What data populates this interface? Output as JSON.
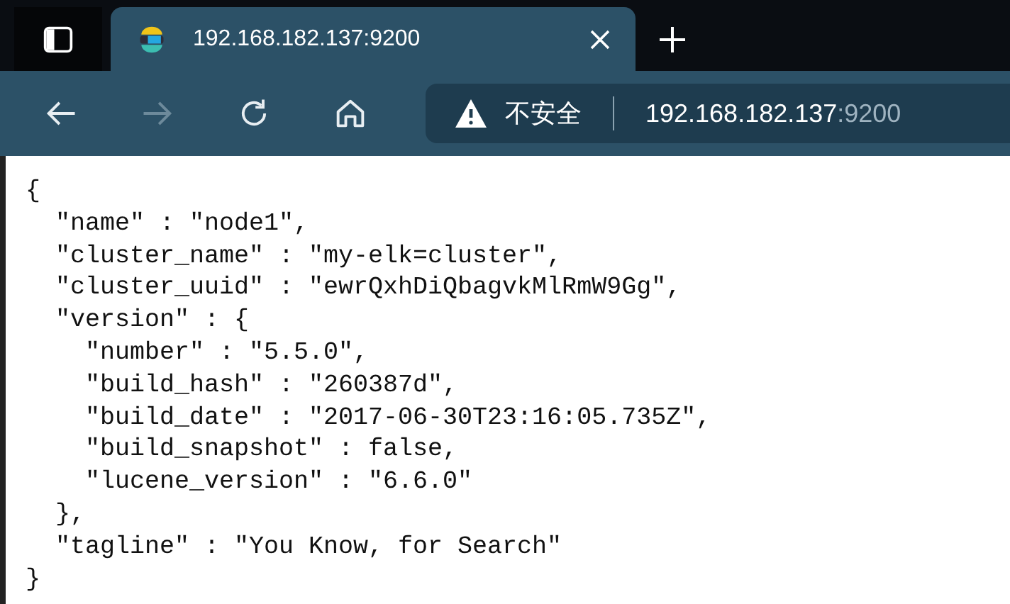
{
  "tabs": [
    {
      "title": "192.168.182.137:9200",
      "selected": true
    }
  ],
  "toolbar": {
    "forward_disabled": true
  },
  "address_bar": {
    "security_label": "不安全",
    "host": "192.168.182.137",
    "port": ":9200"
  },
  "page": {
    "lines": [
      "{",
      "  \"name\" : \"node1\",",
      "  \"cluster_name\" : \"my-elk=cluster\",",
      "  \"cluster_uuid\" : \"ewrQxhDiQbagvkMlRmW9Gg\",",
      "  \"version\" : {",
      "    \"number\" : \"5.5.0\",",
      "    \"build_hash\" : \"260387d\",",
      "    \"build_date\" : \"2017-06-30T23:16:05.735Z\",",
      "    \"build_snapshot\" : false,",
      "    \"lucene_version\" : \"6.6.0\"",
      "  },",
      "  \"tagline\" : \"You Know, for Search\"",
      "}"
    ]
  }
}
